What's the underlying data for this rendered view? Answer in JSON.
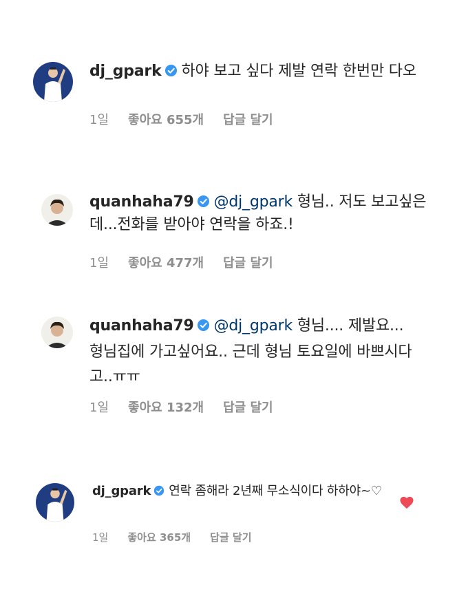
{
  "comments": [
    {
      "username": "dj_gpark",
      "verified": true,
      "mention": "",
      "text": "하야 보고 싶다 제발 연락 한번만 다오",
      "time": "1일",
      "likes": "좋아요 655개",
      "reply": "답글 달기"
    },
    {
      "username": "quanhaha79",
      "verified": true,
      "mention": "@dj_gpark",
      "text": "형님.. 저도 보고싶은데...전화를 받아야 연락을 하죠.!",
      "time": "1일",
      "likes": "좋아요 477개",
      "reply": "답글 달기"
    },
    {
      "username": "quanhaha79",
      "verified": true,
      "mention": "@dj_gpark",
      "text": "형님.... 제발요... 형님집에 가고싶어요.. 근데 형님 토요일에 바쁘시다고..ㅠㅠ",
      "time": "1일",
      "likes": "좋아요 132개",
      "reply": "답글 달기"
    },
    {
      "username": "dj_gpark",
      "verified": true,
      "mention": "",
      "text": "연락 좀해라 2년째 무소식이다 하하야~♡",
      "time": "1일",
      "likes": "좋아요 365개",
      "reply": "답글 달기",
      "liked": true
    }
  ],
  "colors": {
    "verified": "#3897f0",
    "mention": "#00376b",
    "meta": "#8e8e8e",
    "heart": "#ed4956"
  },
  "icons": {
    "verified": "verified-badge-icon",
    "like": "heart-icon"
  }
}
